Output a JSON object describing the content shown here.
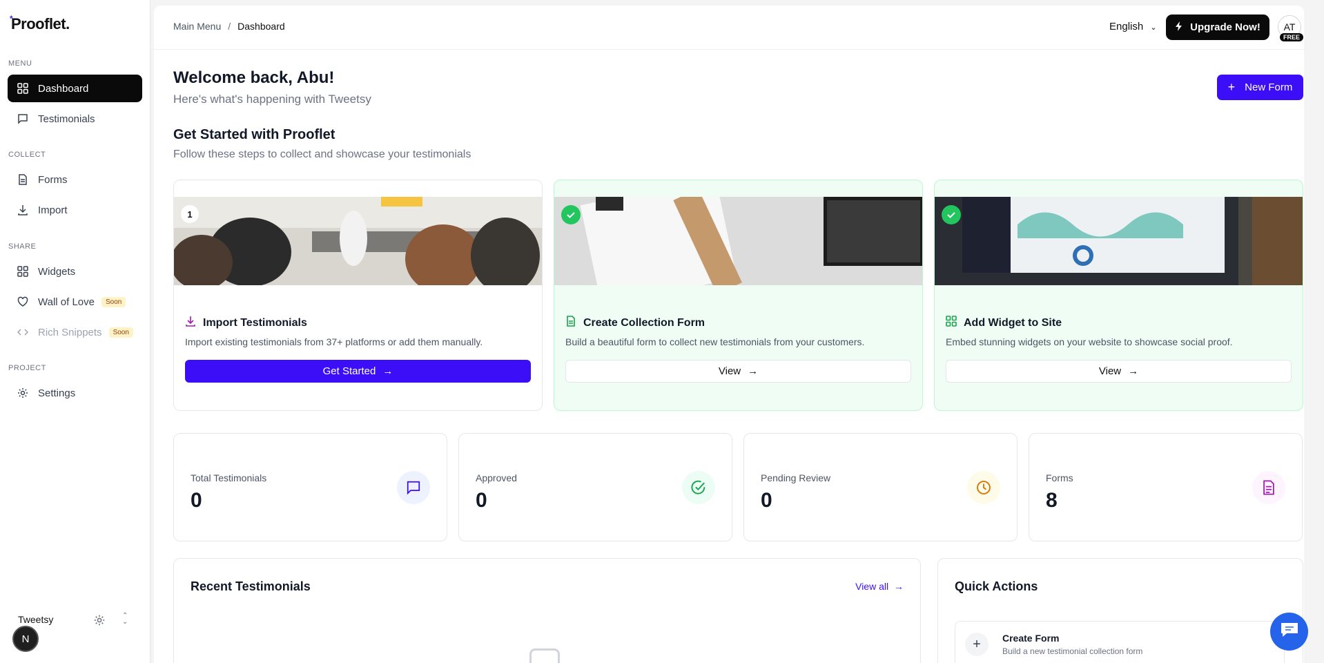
{
  "app": {
    "logo": "Prooflet.",
    "logo_mark": "*"
  },
  "sidebar": {
    "sections": {
      "menu": "MENU",
      "collect": "COLLECT",
      "share": "SHARE",
      "project": "PROJECT"
    },
    "items": [
      {
        "label": "Dashboard",
        "icon": "grid-icon"
      },
      {
        "label": "Testimonials",
        "icon": "message-square-icon"
      },
      {
        "label": "Forms",
        "icon": "file-icon"
      },
      {
        "label": "Import",
        "icon": "download-icon"
      },
      {
        "label": "Widgets",
        "icon": "grid-icon"
      },
      {
        "label": "Wall of Love",
        "icon": "heart-icon",
        "badge": "Soon"
      },
      {
        "label": "Rich Snippets",
        "icon": "code-icon",
        "badge": "Soon"
      },
      {
        "label": "Settings",
        "icon": "gear-icon"
      }
    ],
    "workspace": "Tweetsy",
    "n_badge": "N"
  },
  "topbar": {
    "breadcrumb": {
      "root": "Main Menu",
      "sep": "/",
      "current": "Dashboard"
    },
    "language": "English",
    "upgrade": "Upgrade Now!",
    "avatar": "AT",
    "plan": "FREE"
  },
  "header": {
    "welcome": "Welcome back, Abu!",
    "subtitle": "Here's what's happening with Tweetsy",
    "new_form": "New Form"
  },
  "get_started": {
    "title": "Get Started with Prooflet",
    "subtitle": "Follow these steps to collect and showcase your testimonials",
    "steps": [
      {
        "number": "1",
        "title": "Import Testimonials",
        "desc": "Import existing testimonials from 37+ platforms or add them manually.",
        "button": "Get Started",
        "done": false
      },
      {
        "title": "Create Collection Form",
        "desc": "Build a beautiful form to collect new testimonials from your customers.",
        "button": "View",
        "done": true
      },
      {
        "title": "Add Widget to Site",
        "desc": "Embed stunning widgets on your website to showcase social proof.",
        "button": "View",
        "done": true
      }
    ]
  },
  "stats": [
    {
      "label": "Total Testimonials",
      "value": "0",
      "color": "#3b0ef7",
      "bg": "#eef2ff"
    },
    {
      "label": "Approved",
      "value": "0",
      "color": "#16a34a",
      "bg": "#ecfdf5"
    },
    {
      "label": "Pending Review",
      "value": "0",
      "color": "#d97706",
      "bg": "#fefce8"
    },
    {
      "label": "Forms",
      "value": "8",
      "color": "#a21caf",
      "bg": "#fdf4ff"
    }
  ],
  "recent": {
    "title": "Recent Testimonials",
    "view_all": "View all"
  },
  "quick_actions": {
    "title": "Quick Actions",
    "items": [
      {
        "title": "Create Form",
        "desc": "Build a new testimonial collection form"
      }
    ]
  },
  "colors": {
    "accent": "#3b0ef7",
    "dark": "#0a0a0a",
    "success": "#22c55e"
  }
}
